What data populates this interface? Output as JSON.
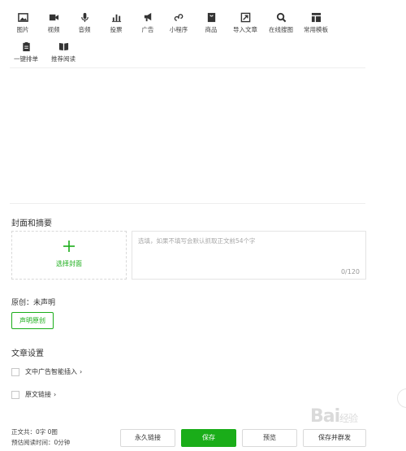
{
  "toolbar": {
    "items": [
      {
        "label": "图片",
        "icon": "image-icon"
      },
      {
        "label": "视频",
        "icon": "video-icon"
      },
      {
        "label": "音频",
        "icon": "audio-icon"
      },
      {
        "label": "投票",
        "icon": "vote-icon"
      },
      {
        "label": "广告",
        "icon": "ad-icon"
      },
      {
        "label": "小程序",
        "icon": "mini-program-icon"
      },
      {
        "label": "商品",
        "icon": "goods-icon"
      },
      {
        "label": "导入文章",
        "icon": "import-icon"
      },
      {
        "label": "在线搜图",
        "icon": "search-icon"
      },
      {
        "label": "常用模板",
        "icon": "template-icon"
      },
      {
        "label": "一键排单",
        "icon": "clipboard-icon"
      },
      {
        "label": "推荐阅读",
        "icon": "book-icon"
      }
    ]
  },
  "cover": {
    "section_title": "封面和摘要",
    "select_label": "选择封面",
    "summary_placeholder": "选填，如果不填写会默认抓取正文前54个字",
    "summary_count": "0/120"
  },
  "original": {
    "status_text": "原创：未声明",
    "declare_button": "声明原创"
  },
  "settings": {
    "section_title": "文章设置",
    "ad_insert_label": "文中广告智能插入",
    "original_link_label": "原文链接"
  },
  "footer": {
    "word_count": "正文共：0字 0图",
    "read_time": "预估阅读时间：0分钟",
    "permalink_button": "永久链接",
    "save_button": "保存",
    "preview_button": "预览",
    "save_send_button": "保存并群发"
  },
  "watermark": {
    "text": "Bai",
    "suffix": "经验"
  },
  "colors": {
    "accent": "#1aad19"
  }
}
